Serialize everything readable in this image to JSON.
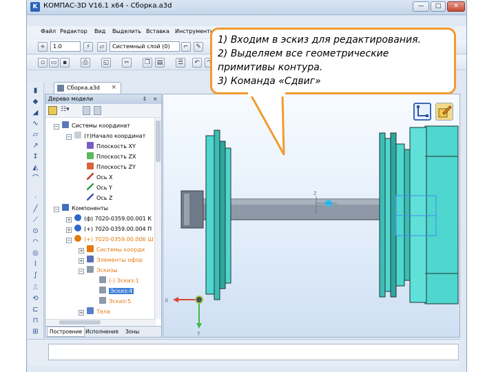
{
  "window": {
    "title": "КОМПАС-3D V16.1 x64 - Сборка.a3d",
    "buttons": {
      "minimize": "—",
      "maximize": "□",
      "close": "✕"
    }
  },
  "menu": [
    "Файл",
    "Редактор",
    "Вид",
    "Выделить",
    "Вставка",
    "Инструменты"
  ],
  "toolbar": {
    "step_value": "1.0",
    "layer_value": "Системный слой (0)"
  },
  "document_tab": {
    "label": "Сборка.a3d",
    "close": "×"
  },
  "tree": {
    "header": "Дерево модели",
    "pin": "‡",
    "close": "×",
    "rows": [
      {
        "label": "Системы координат"
      },
      {
        "label": "(т)Начало координат"
      },
      {
        "label": "Плоскость XY"
      },
      {
        "label": "Плоскость ZX"
      },
      {
        "label": "Плоскость ZY"
      },
      {
        "label": "Ось X"
      },
      {
        "label": "Ось Y"
      },
      {
        "label": "Ось Z"
      },
      {
        "label": "Компоненты"
      },
      {
        "label": "(ф) 7020-0359.00.001 К"
      },
      {
        "label": "(+) 7020-0359.00.004 П"
      },
      {
        "label": "(+) 7020-0359.00.006 Ш"
      },
      {
        "label": "Системы коорди"
      },
      {
        "label": "Элементы офор"
      },
      {
        "label": "Эскизы"
      },
      {
        "label": "(-) Эскиз:1"
      },
      {
        "label": "Эскиз:4"
      },
      {
        "label": "Эскиз:5"
      },
      {
        "label": "Тела"
      }
    ],
    "bottom_tabs": [
      "Построение",
      "Исполнения",
      "Зоны"
    ]
  },
  "viewport": {
    "axis_x": "X",
    "axis_y": "Y",
    "axis_z": "Z"
  },
  "callout": {
    "lines": [
      "1) Входим в эскиз для редактирования.",
      "2) Выделяем все геометрические",
      "примитивы контура.",
      "3) Команда «Сдвиг»"
    ],
    "border_color": "#f29a2e"
  },
  "colors": {
    "part_fill": "#4fd6cf",
    "shaft_fill": "#8e99a7",
    "selection": "#3d7dd8",
    "orange_text": "#e07a10"
  }
}
